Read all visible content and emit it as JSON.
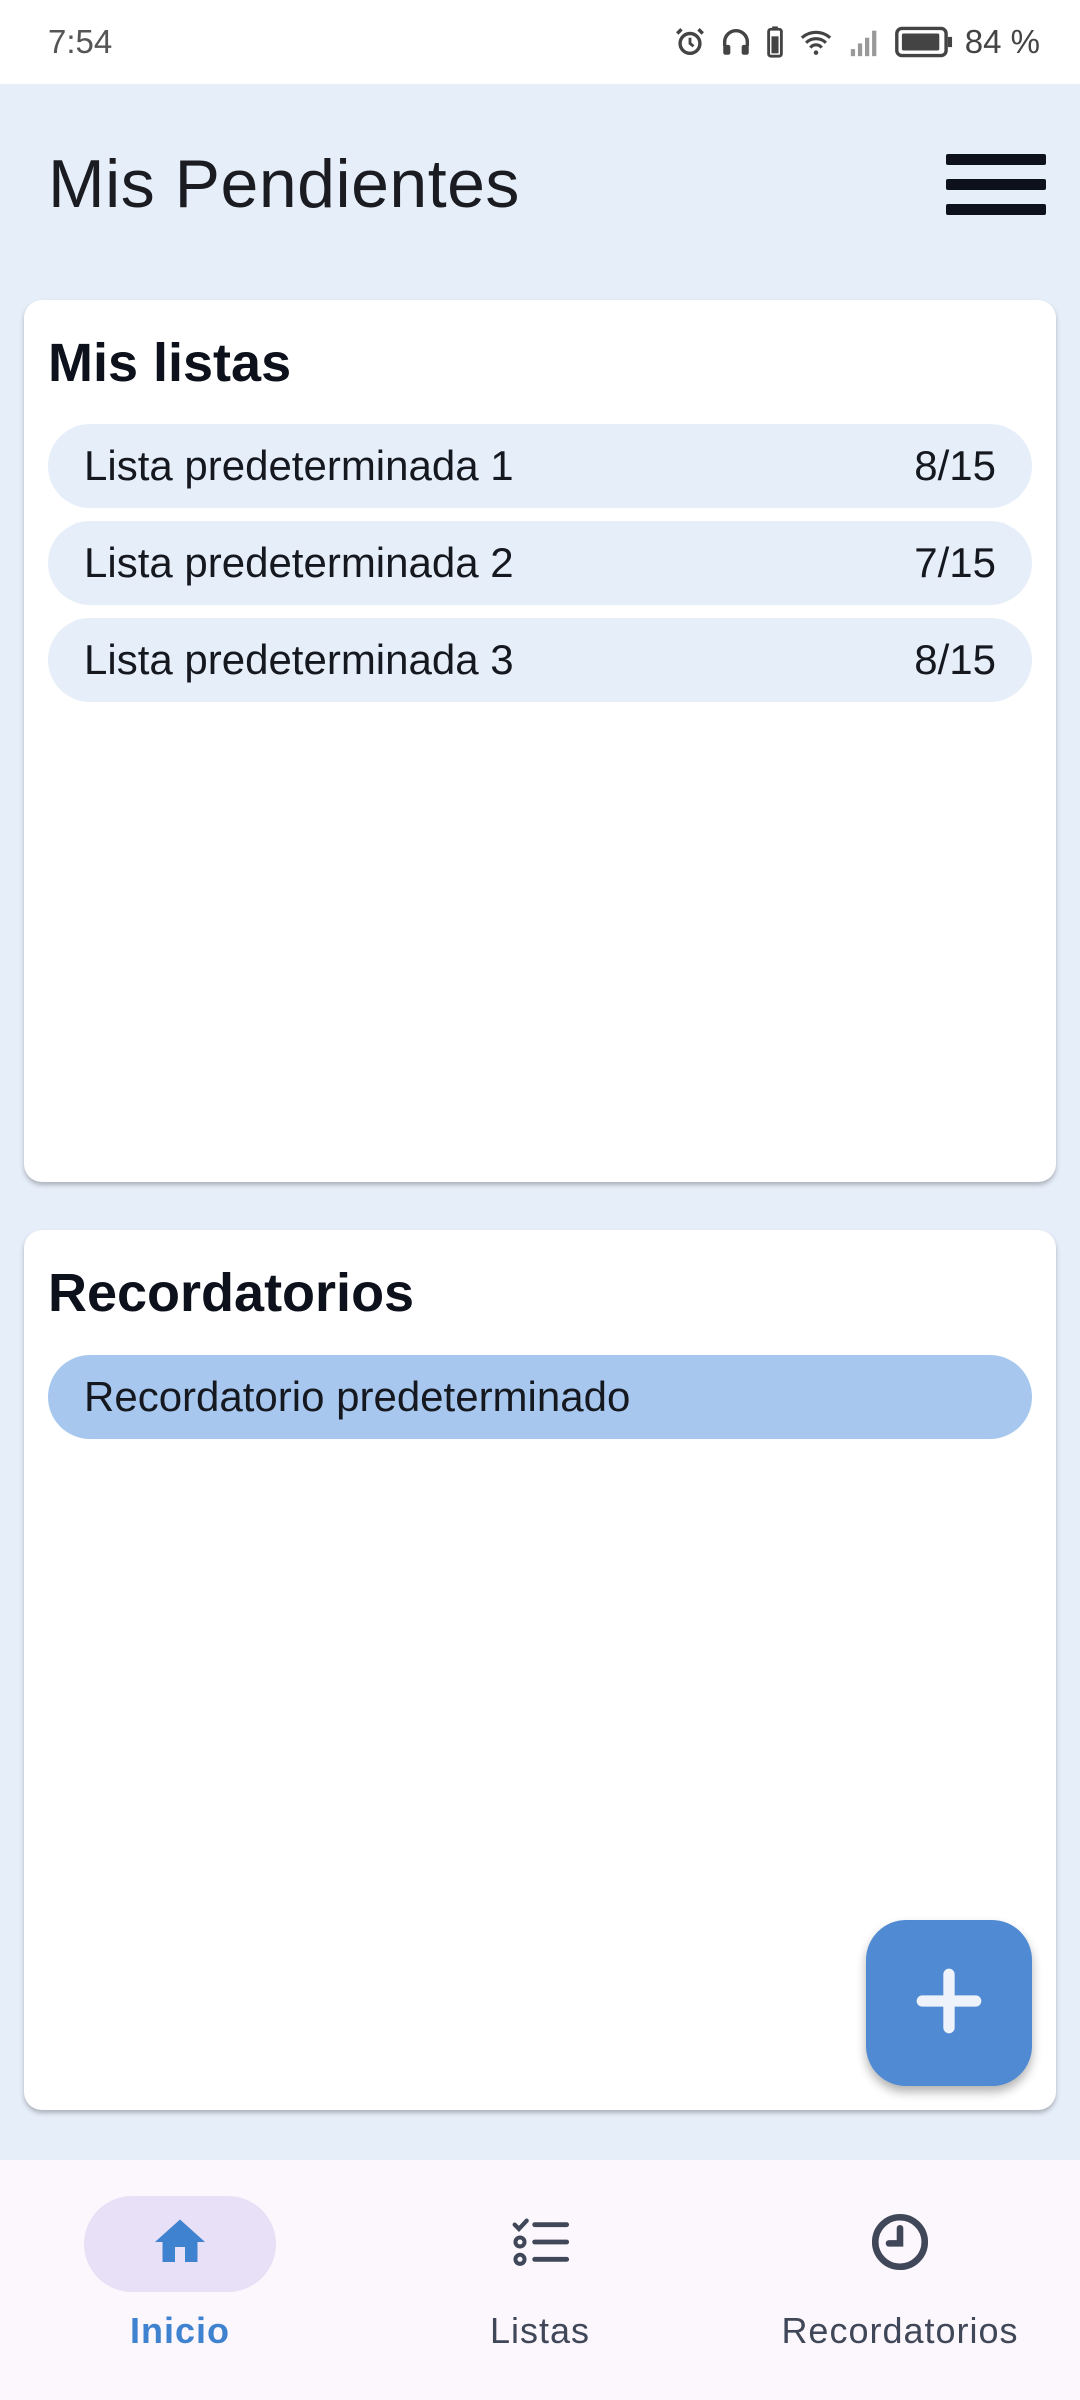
{
  "status_bar": {
    "time": "7:54",
    "battery": "84 %"
  },
  "app_bar": {
    "title": "Mis Pendientes",
    "menu_icon": "hamburger-menu-icon"
  },
  "lists_card": {
    "title": "Mis listas",
    "items": [
      {
        "name": "Lista predeterminada 1",
        "count": "8/15"
      },
      {
        "name": "Lista predeterminada 2",
        "count": "7/15"
      },
      {
        "name": "Lista predeterminada 3",
        "count": "8/15"
      }
    ]
  },
  "reminders_card": {
    "title": "Recordatorios",
    "items": [
      {
        "name": "Recordatorio predeterminado"
      }
    ]
  },
  "fab": {
    "icon": "plus-icon"
  },
  "bottom_nav": {
    "items": [
      {
        "label": "Inicio",
        "icon": "home-icon",
        "active": true
      },
      {
        "label": "Listas",
        "icon": "checklist-icon",
        "active": false
      },
      {
        "label": "Recordatorios",
        "icon": "clock-icon",
        "active": false
      }
    ]
  },
  "colors": {
    "background": "#e6eef9",
    "accent": "#4f8ad3",
    "reminder_row": "#a7c7ee",
    "nav_active_pill": "#e7e0f6"
  }
}
